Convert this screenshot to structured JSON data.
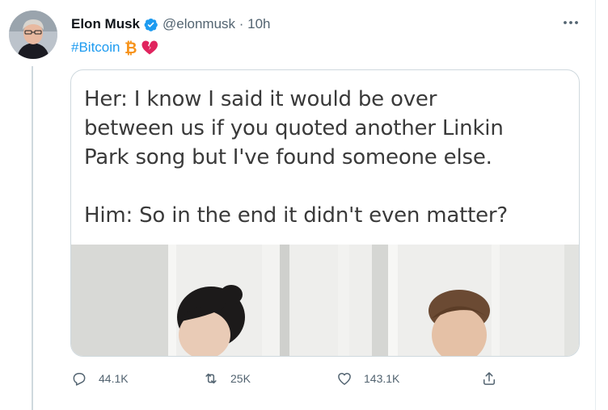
{
  "tweet": {
    "author_name": "Elon Musk",
    "handle_time": "@elonmusk · 10h",
    "hashtag": "#Bitcoin",
    "emoji_icons": [
      "bitcoin-icon",
      "broken-heart-icon"
    ],
    "colors": {
      "accent": "#1d9bf0",
      "bitcoin": "#f7931a",
      "broken_heart": "#e0245e",
      "muted": "#536471"
    }
  },
  "meme": {
    "line1": "Her: I know I said it would be over",
    "line2": "between us if you quoted another Linkin",
    "line3": "Park song but I've found someone else.",
    "line4": "Him: So in the end it didn't even matter?"
  },
  "actions": {
    "replies": "44.1K",
    "retweets": "25K",
    "likes": "143.1K"
  }
}
